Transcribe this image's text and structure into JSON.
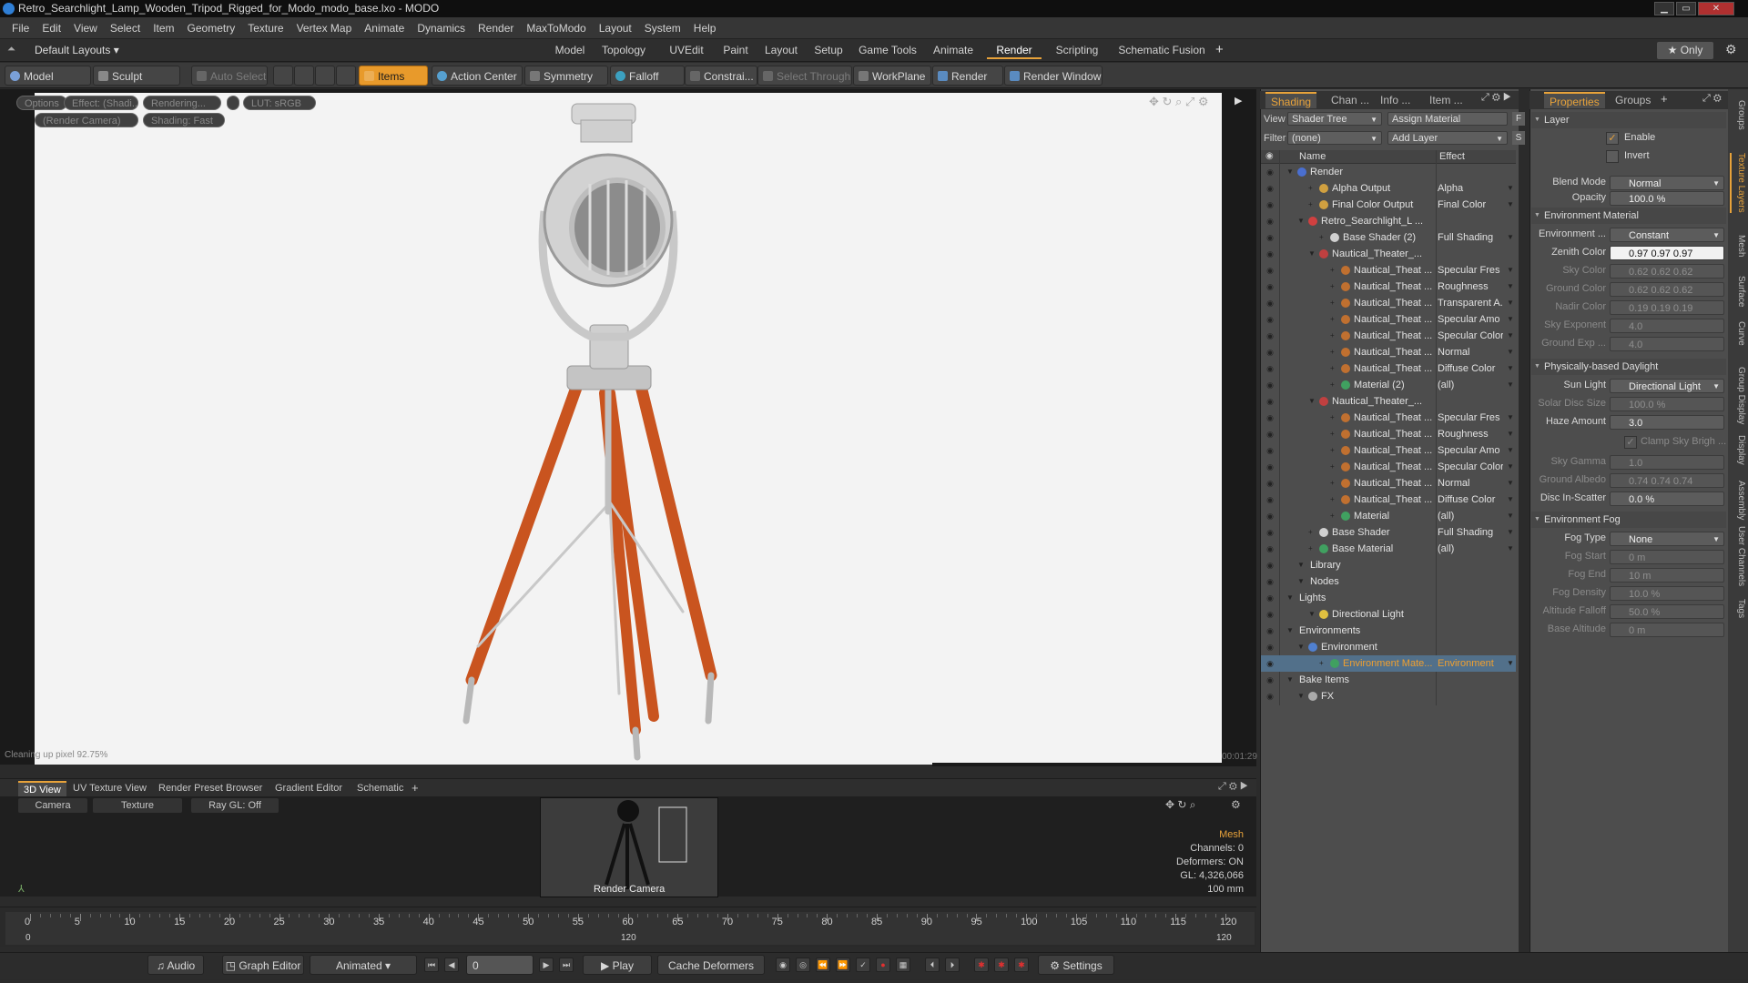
{
  "window": {
    "title": "Retro_Searchlight_Lamp_Wooden_Tripod_Rigged_for_Modo_modo_base.lxo - MODO"
  },
  "menu": [
    "File",
    "Edit",
    "View",
    "Select",
    "Item",
    "Geometry",
    "Texture",
    "Vertex Map",
    "Animate",
    "Dynamics",
    "Render",
    "MaxToModo",
    "Layout",
    "System",
    "Help"
  ],
  "layouts": {
    "selector": "Default Layouts",
    "tabs": [
      "Model",
      "Topology",
      "UVEdit",
      "Paint",
      "Layout",
      "Setup",
      "Game Tools",
      "Animate",
      "Render",
      "Scripting",
      "Schematic Fusion"
    ],
    "active": "Render",
    "only": "Only"
  },
  "toolbar": {
    "model": "Model",
    "sculpt": "Sculpt",
    "auto_select": "Auto Select",
    "items": "Items",
    "action_center": "Action Center",
    "symmetry": "Symmetry",
    "falloff": "Falloff",
    "constraint": "Constrai...",
    "select_through": "Select Through",
    "workplane": "WorkPlane",
    "render": "Render",
    "render_window": "Render Window"
  },
  "viewport": {
    "options": "Options",
    "effect": "Effect: (Shadi...",
    "rendering": "Rendering...",
    "lut": "LUT: sRGB",
    "camera": "(Render Camera)",
    "shading": "Shading: Fast",
    "status": "Cleaning up pixel 92.75%",
    "time": "00:01:29"
  },
  "viewtabs": [
    "3D View",
    "UV Texture View",
    "Render Preset Browser",
    "Gradient Editor",
    "Schematic"
  ],
  "bottomview": {
    "camera": "Camera",
    "texture": "Texture",
    "raygl": "Ray GL: Off",
    "thumb_label": "Render Camera",
    "mesh": "Mesh",
    "channels": "Channels: 0",
    "deformers": "Deformers: ON",
    "gl": "GL: 4,326,066",
    "size": "100 mm"
  },
  "timeline": {
    "ticks": [
      "0",
      "5",
      "10",
      "15",
      "20",
      "25",
      "30",
      "35",
      "40",
      "45",
      "50",
      "55",
      "60",
      "65",
      "70",
      "75",
      "80",
      "85",
      "90",
      "95",
      "100",
      "105",
      "110",
      "115",
      "120"
    ],
    "start": "0",
    "mid": "120",
    "end": "120"
  },
  "transport": {
    "audio": "Audio",
    "graph_editor": "Graph Editor",
    "animated": "Animated",
    "frame": "0",
    "play": "Play",
    "cache": "Cache Deformers",
    "settings": "Settings"
  },
  "shading": {
    "tabs": [
      "Shading",
      "Chan ...",
      "Info ...",
      "Item ..."
    ],
    "view_label": "View",
    "view_value": "Shader Tree",
    "assign": "Assign Material",
    "filter_label": "Filter",
    "filter_value": "(none)",
    "add_layer": "Add Layer",
    "col_name": "Name",
    "col_effect": "Effect",
    "rows": [
      {
        "name": "Render",
        "effect": "",
        "indent": 0,
        "icon": "#4a6fd0"
      },
      {
        "name": "Alpha Output",
        "effect": "Alpha",
        "indent": 2,
        "icon": "#d0a040"
      },
      {
        "name": "Final Color Output",
        "effect": "Final Color",
        "indent": 2,
        "icon": "#d0a040"
      },
      {
        "name": "Retro_Searchlight_L ...",
        "effect": "",
        "indent": 1,
        "icon": "#d04040"
      },
      {
        "name": "Base Shader (2)",
        "effect": "Full Shading",
        "indent": 3,
        "icon": "#d0d0d0"
      },
      {
        "name": "Nautical_Theater_...",
        "effect": "",
        "indent": 2,
        "icon": "#c04040"
      },
      {
        "name": "Nautical_Theat ...",
        "effect": "Specular Fres ...",
        "indent": 4,
        "icon": "#c07030"
      },
      {
        "name": "Nautical_Theat ...",
        "effect": "Roughness",
        "indent": 4,
        "icon": "#c07030"
      },
      {
        "name": "Nautical_Theat ...",
        "effect": "Transparent A...",
        "indent": 4,
        "icon": "#c07030"
      },
      {
        "name": "Nautical_Theat ...",
        "effect": "Specular Amo ...",
        "indent": 4,
        "icon": "#c07030"
      },
      {
        "name": "Nautical_Theat ...",
        "effect": "Specular Color",
        "indent": 4,
        "icon": "#c07030"
      },
      {
        "name": "Nautical_Theat ...",
        "effect": "Normal",
        "indent": 4,
        "icon": "#c07030"
      },
      {
        "name": "Nautical_Theat ...",
        "effect": "Diffuse Color",
        "indent": 4,
        "icon": "#c07030"
      },
      {
        "name": "Material (2)",
        "effect": "(all)",
        "indent": 4,
        "icon": "#40a060"
      },
      {
        "name": "Nautical_Theater_...",
        "effect": "",
        "indent": 2,
        "icon": "#c04040"
      },
      {
        "name": "Nautical_Theat ...",
        "effect": "Specular Fres ...",
        "indent": 4,
        "icon": "#c07030"
      },
      {
        "name": "Nautical_Theat ...",
        "effect": "Roughness",
        "indent": 4,
        "icon": "#c07030"
      },
      {
        "name": "Nautical_Theat ...",
        "effect": "Specular Amo ...",
        "indent": 4,
        "icon": "#c07030"
      },
      {
        "name": "Nautical_Theat ...",
        "effect": "Specular Color",
        "indent": 4,
        "icon": "#c07030"
      },
      {
        "name": "Nautical_Theat ...",
        "effect": "Normal",
        "indent": 4,
        "icon": "#c07030"
      },
      {
        "name": "Nautical_Theat ...",
        "effect": "Diffuse Color",
        "indent": 4,
        "icon": "#c07030"
      },
      {
        "name": "Material",
        "effect": "(all)",
        "indent": 4,
        "icon": "#40a060"
      },
      {
        "name": "Base Shader",
        "effect": "Full Shading",
        "indent": 2,
        "icon": "#d0d0d0"
      },
      {
        "name": "Base Material",
        "effect": "(all)",
        "indent": 2,
        "icon": "#40a060"
      },
      {
        "name": "Library",
        "effect": "",
        "indent": 1,
        "icon": ""
      },
      {
        "name": "Nodes",
        "effect": "",
        "indent": 1,
        "icon": ""
      },
      {
        "name": "Lights",
        "effect": "",
        "indent": 0,
        "icon": ""
      },
      {
        "name": "Directional Light",
        "effect": "",
        "indent": 2,
        "icon": "#e0c040"
      },
      {
        "name": "Environments",
        "effect": "",
        "indent": 0,
        "icon": ""
      },
      {
        "name": "Environment",
        "effect": "",
        "indent": 1,
        "icon": "#5080d0"
      },
      {
        "name": "Environment Mate...",
        "effect": "Environment",
        "indent": 3,
        "icon": "#40a060",
        "selected": true
      },
      {
        "name": "Bake Items",
        "effect": "",
        "indent": 0,
        "icon": ""
      },
      {
        "name": "FX",
        "effect": "",
        "indent": 1,
        "icon": "#aaaaaa"
      }
    ]
  },
  "properties": {
    "tabs": [
      "Properties",
      "Groups"
    ],
    "layer": "Layer",
    "enable": "Enable",
    "invert": "Invert",
    "blend_mode": "Blend Mode",
    "blend_value": "Normal",
    "opacity": "Opacity",
    "opacity_value": "100.0 %",
    "env_material": "Environment Material",
    "environment": "Environment ...",
    "env_value": "Constant",
    "zenith": "Zenith Color",
    "zenith_value": "0.97 0.97 0.97",
    "sky": "Sky Color",
    "sky_value": "0.62 0.62 0.62",
    "ground": "Ground Color",
    "ground_value": "0.62 0.62 0.62",
    "nadir": "Nadir Color",
    "nadir_value": "0.19 0.19 0.19",
    "sky_exp": "Sky Exponent",
    "sky_exp_value": "4.0",
    "ground_exp": "Ground Exp ...",
    "ground_exp_value": "4.0",
    "pb_daylight": "Physically-based Daylight",
    "sun_light": "Sun Light",
    "sun_value": "Directional Light",
    "solar": "Solar Disc Size",
    "solar_value": "100.0 %",
    "haze": "Haze Amount",
    "haze_value": "3.0",
    "clamp": "Clamp Sky Brigh ...",
    "sky_gamma": "Sky Gamma",
    "sky_gamma_value": "1.0",
    "albedo": "Ground Albedo",
    "albedo_value": "0.74 0.74 0.74",
    "disc": "Disc In-Scatter",
    "disc_value": "0.0 %",
    "env_fog": "Environment Fog",
    "fog_type": "Fog Type",
    "fog_type_value": "None",
    "fog_start": "Fog Start",
    "fog_start_value": "0 m",
    "fog_end": "Fog End",
    "fog_end_value": "10 m",
    "fog_density": "Fog Density",
    "fog_density_value": "10.0 %",
    "alt_falloff": "Altitude Falloff",
    "alt_falloff_value": "50.0 %",
    "base_alt": "Base Altitude",
    "base_alt_value": "0 m"
  },
  "side_tabs": [
    "Groups",
    "Texture Layers",
    "Mesh",
    "Surface",
    "Curve",
    "Group Display",
    "Display",
    "Assembly",
    "User Channels",
    "Tags"
  ],
  "colors": {
    "accent": "#e7a23a",
    "wood": "#c9541f",
    "metal": "#b9b9b9",
    "background": "#f3f3f3"
  }
}
